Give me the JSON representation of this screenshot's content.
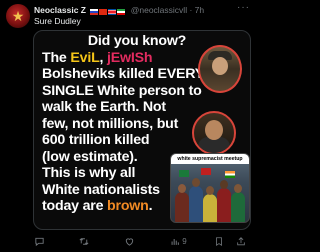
{
  "post": {
    "author_name": "Neoclassic Z",
    "handle": "@neoclassicvll",
    "time": "· 7h",
    "text": "Sure Dudley",
    "more_label": "···"
  },
  "image": {
    "line1": "Did you know?",
    "line2_pre": "The ",
    "line2_evil": "EviL",
    "line2_comma": ", ",
    "line2_jewish": "jEwISh",
    "line3": "Bolsheviks killed EVERY",
    "line4_pre": "SINGLE ",
    "line4_white": "White",
    "line4_post": " person to",
    "line5": "walk the Earth. Not",
    "line6": "few, not millions, but",
    "line7": "600 trillion killed",
    "line8": "(low estimate).",
    "line9": "This is why all",
    "line10_white": "White",
    "line10_post": " nationalists",
    "line11_pre": "today are ",
    "line11_brown": "brown",
    "line11_post": ".",
    "meetup_caption": "white supremacist meetup"
  },
  "actions": {
    "views": "9"
  },
  "colors": {
    "evil": "#f5c518",
    "jewish": "#e22b5f",
    "brown": "#f08a24",
    "background": "#000000",
    "muted": "#71767b"
  },
  "icons": [
    "reply-icon",
    "retweet-icon",
    "like-icon",
    "views-icon",
    "bookmark-icon",
    "share-icon"
  ]
}
